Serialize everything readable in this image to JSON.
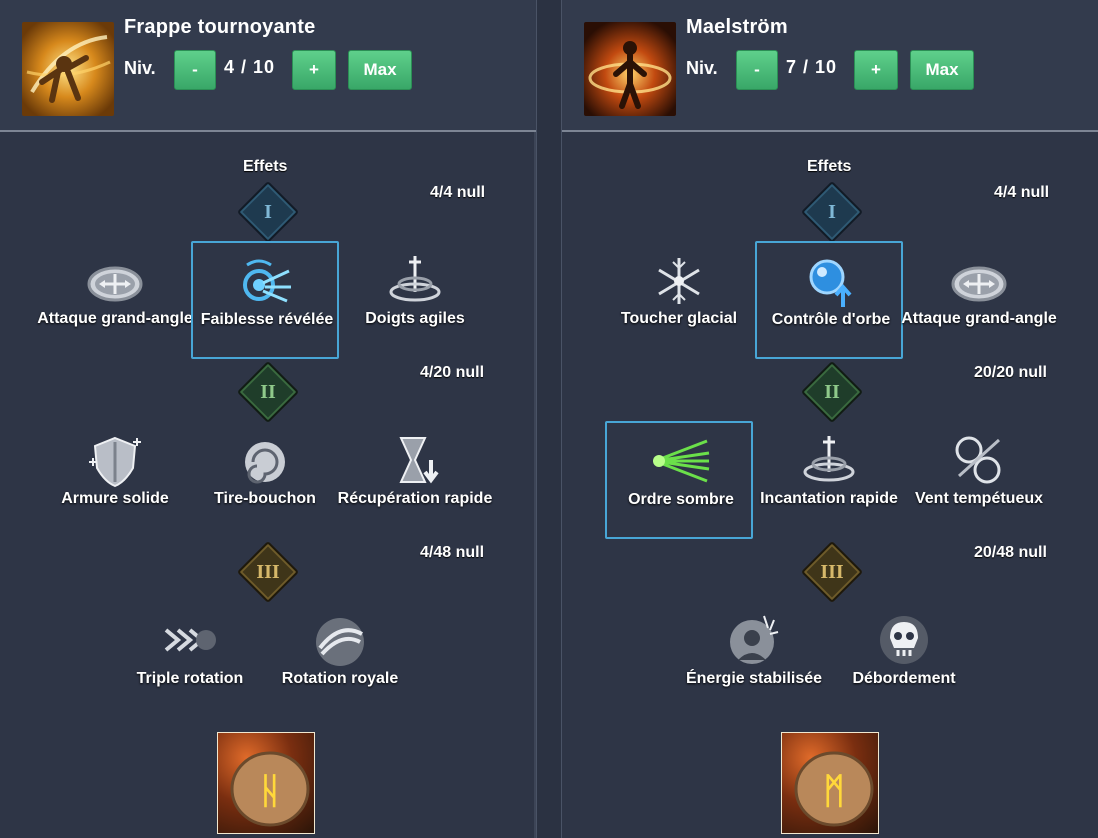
{
  "panels": [
    {
      "skill_name": "Frappe tournoyante",
      "level_label": "Niv.",
      "level": "4 / 10",
      "minus_label": "-",
      "plus_label": "+",
      "max_label": "Max",
      "effects_label": "Effets",
      "tiers": [
        {
          "numeral": "I",
          "count": "4/4 null",
          "options": [
            "Attaque grand-angle",
            "Faiblesse révélée",
            "Doigts agiles"
          ],
          "selected": 1
        },
        {
          "numeral": "II",
          "count": "4/20 null",
          "options": [
            "Armure solide",
            "Tire-bouchon",
            "Récupération rapide"
          ],
          "selected": -1
        },
        {
          "numeral": "III",
          "count": "4/48 null",
          "options": [
            "Triple rotation",
            "Rotation royale"
          ],
          "selected": -1
        }
      ],
      "rune_glyph": "ᚺ"
    },
    {
      "skill_name": "Maelström",
      "level_label": "Niv.",
      "level": "7 / 10",
      "minus_label": "-",
      "plus_label": "+",
      "max_label": "Max",
      "effects_label": "Effets",
      "tiers": [
        {
          "numeral": "I",
          "count": "4/4 null",
          "options": [
            "Toucher glacial",
            "Contrôle d'orbe",
            "Attaque grand-angle"
          ],
          "selected": 1
        },
        {
          "numeral": "II",
          "count": "20/20 null",
          "options": [
            "Ordre sombre",
            "Incantation rapide",
            "Vent tempétueux"
          ],
          "selected": 0
        },
        {
          "numeral": "III",
          "count": "20/48 null",
          "options": [
            "Énergie stabilisée",
            "Débordement"
          ],
          "selected": -1
        }
      ],
      "rune_glyph": "ᛗ"
    }
  ],
  "icons": {
    "left": {
      "skill": "whirling-strike-icon",
      "tier1": [
        "wide-angle-icon",
        "revealed-weakness-icon",
        "agile-fingers-icon"
      ],
      "tier2": [
        "solid-armor-icon",
        "corkscrew-icon",
        "rapid-recovery-icon"
      ],
      "tier3": [
        "triple-rotation-icon",
        "royal-rotation-icon"
      ],
      "rune": "rune-icon"
    },
    "right": {
      "skill": "maelstrom-icon",
      "tier1": [
        "frost-touch-icon",
        "orb-control-icon",
        "wide-angle-icon"
      ],
      "tier2": [
        "dark-order-icon",
        "quick-incantation-icon",
        "tempest-wind-icon"
      ],
      "tier3": [
        "stabilized-energy-icon",
        "overflow-icon"
      ],
      "rune": "rune-icon"
    }
  },
  "colors": {
    "background": "#2e3546",
    "button_green": "#4cbd7b",
    "selected_border": "#48a6d6",
    "text": "#ffffff"
  }
}
